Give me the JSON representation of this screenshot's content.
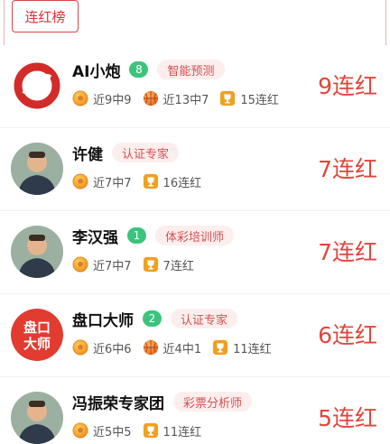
{
  "header": {
    "tab_label": "连红榜"
  },
  "experts": [
    {
      "name": "AI小炮",
      "level": "8",
      "tag": "智能预测",
      "stats": [
        {
          "icon": "football-icon",
          "text": "近9中9"
        },
        {
          "icon": "basketball-icon",
          "text": "近13中7"
        },
        {
          "icon": "trophy-icon",
          "text": "15连红"
        }
      ],
      "streak": "9连红",
      "avatar": "ai-logo-avatar"
    },
    {
      "name": "许健",
      "level": null,
      "tag": "认证专家",
      "stats": [
        {
          "icon": "football-icon",
          "text": "近7中7"
        },
        {
          "icon": "trophy-icon",
          "text": "16连红"
        }
      ],
      "streak": "7连红",
      "avatar": "photo-avatar"
    },
    {
      "name": "李汉强",
      "level": "1",
      "tag": "体彩培训师",
      "stats": [
        {
          "icon": "football-icon",
          "text": "近7中7"
        },
        {
          "icon": "trophy-icon",
          "text": "7连红"
        }
      ],
      "streak": "7连红",
      "avatar": "photo-avatar"
    },
    {
      "name": "盘口大师",
      "level": "2",
      "tag": "认证专家",
      "stats": [
        {
          "icon": "football-icon",
          "text": "近6中6"
        },
        {
          "icon": "basketball-icon",
          "text": "近4中1"
        },
        {
          "icon": "trophy-icon",
          "text": "11连红"
        }
      ],
      "streak": "6连红",
      "avatar": "text-logo-avatar",
      "avatar_text": [
        "盘口",
        "大师"
      ]
    },
    {
      "name": "冯振荣专家团",
      "level": null,
      "tag": "彩票分析师",
      "stats": [
        {
          "icon": "football-icon",
          "text": "近5中5"
        },
        {
          "icon": "trophy-icon",
          "text": "11连红"
        }
      ],
      "streak": "5连红",
      "avatar": "photo-avatar"
    }
  ],
  "colors": {
    "accent": "#e0463c",
    "level_badge": "#3cc47c",
    "tag_bg": "#fdeeee"
  }
}
